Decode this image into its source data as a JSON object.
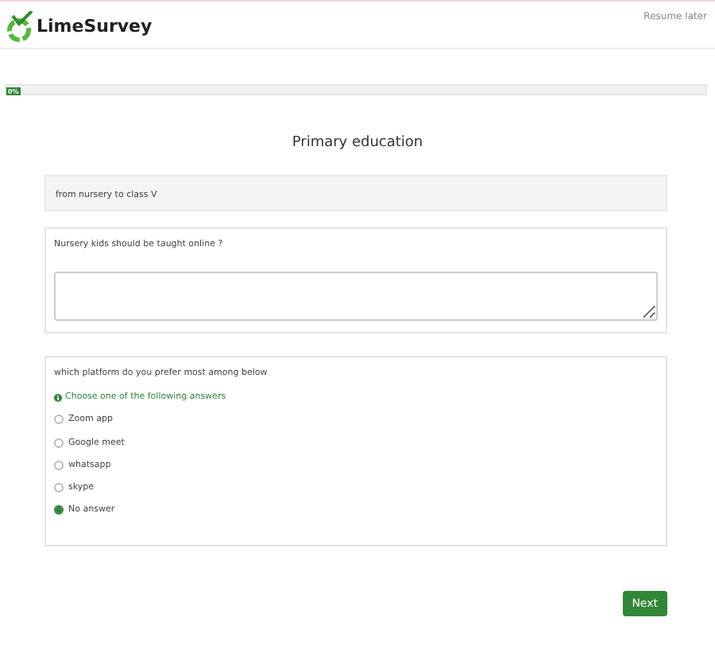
{
  "header": {
    "logo_text": "LimeSurvey",
    "resume_link": "Resume later"
  },
  "progress": {
    "label": "0%",
    "level": 0
  },
  "group": {
    "title": "Primary education",
    "description": "from nursery to class V"
  },
  "questions": [
    {
      "kind": "text",
      "text": "Nursery kids should be taught online ?"
    },
    {
      "kind": "radio",
      "text": "which platform do you prefer most among below",
      "hint": "Choose one of the following answers",
      "options": [
        {
          "label": "Zoom app",
          "selected": false
        },
        {
          "label": "Google meet",
          "selected": false
        },
        {
          "label": "whatsapp",
          "selected": false
        },
        {
          "label": "skype",
          "selected": false
        },
        {
          "label": "No answer",
          "selected": true
        }
      ]
    }
  ],
  "next_button": "Next"
}
